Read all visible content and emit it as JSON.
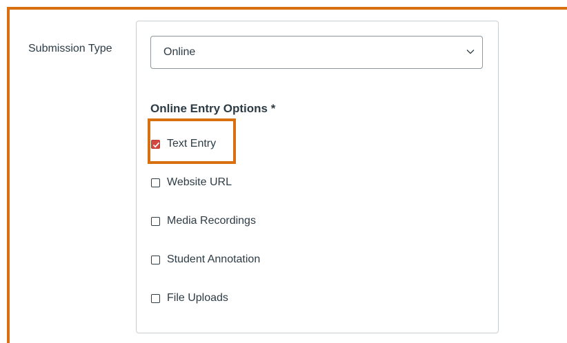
{
  "form": {
    "submission_type_label": "Submission Type",
    "submission_type_select": {
      "value": "Online"
    },
    "online_entry_options": {
      "title": "Online Entry Options *",
      "options": [
        {
          "label": "Text Entry",
          "checked": true
        },
        {
          "label": "Website URL",
          "checked": false
        },
        {
          "label": "Media Recordings",
          "checked": false
        },
        {
          "label": "Student Annotation",
          "checked": false
        },
        {
          "label": "File Uploads",
          "checked": false
        }
      ]
    }
  },
  "colors": {
    "highlight_border": "#d9700f",
    "checkbox_checked": "#d24a3f",
    "text": "#2d3b45",
    "panel_border": "#c7cdd1"
  },
  "icons": {
    "select_chevron": "chevron-down-icon",
    "checkbox_check": "checkmark-icon"
  }
}
